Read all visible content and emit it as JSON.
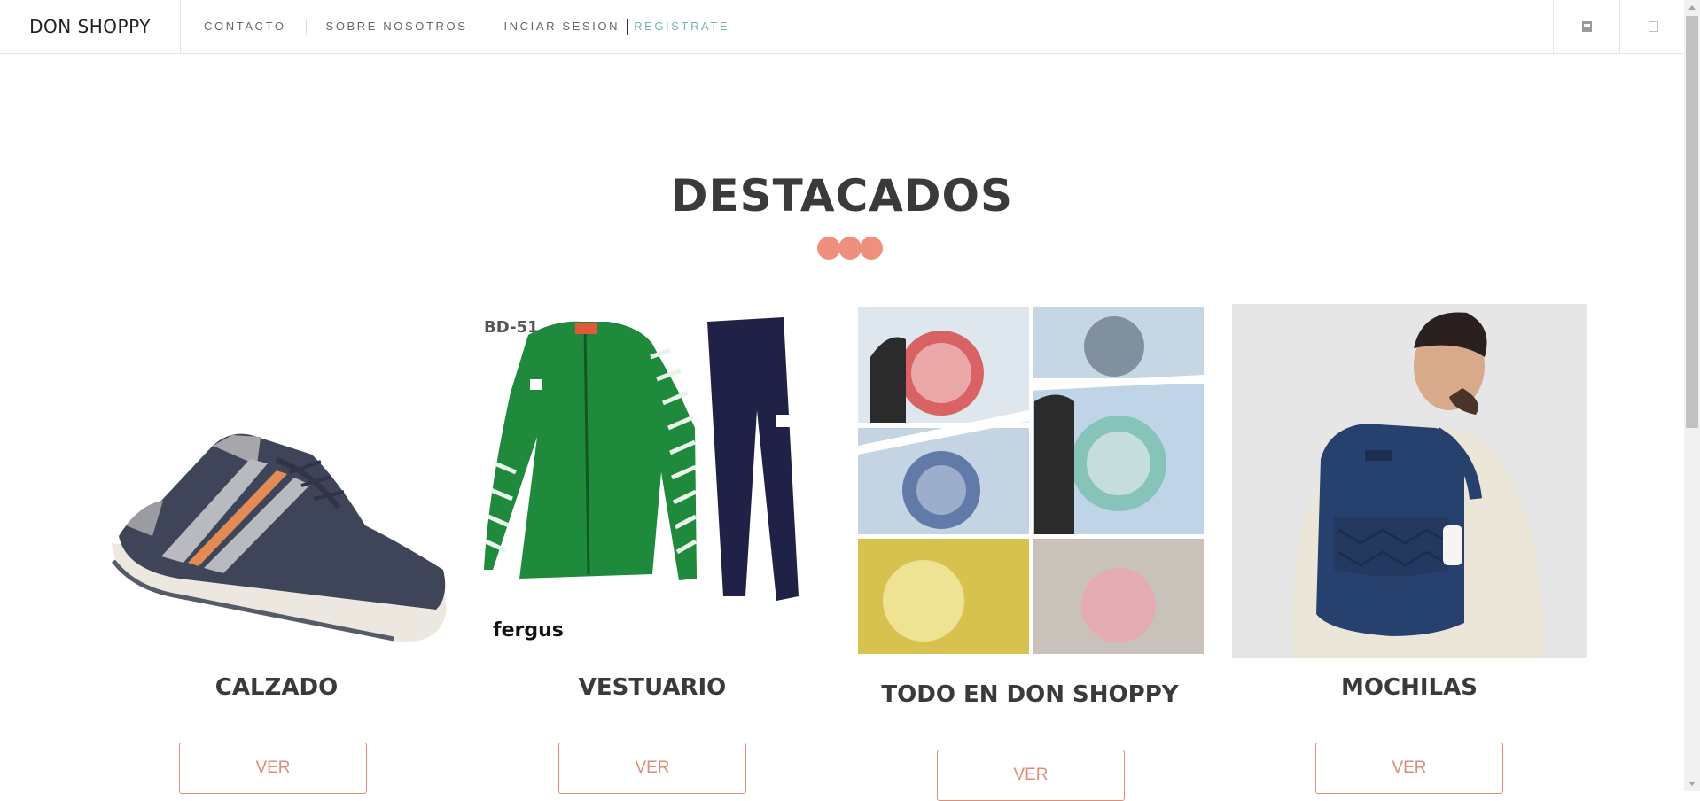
{
  "header": {
    "brand": "DON SHOPPY",
    "nav": [
      "CONTACTO",
      "SOBRE NOSOTROS"
    ],
    "login": "INCIAR SESION",
    "register": "REGISTRATE",
    "icons": [
      "user-icon",
      "cart-icon"
    ]
  },
  "section": {
    "title": "DESTACADOS"
  },
  "cards": [
    {
      "title": "CALZADO",
      "button": "VER",
      "image": "sneaker-image"
    },
    {
      "title": "VESTUARIO",
      "button": "VER",
      "image": "tracksuit-image",
      "image_text": [
        "BD-51",
        "fergus"
      ]
    },
    {
      "title": "TODO EN DON SHOPPY",
      "button": "VER",
      "image": "pet-backpack-collage-image"
    },
    {
      "title": "MOCHILAS",
      "button": "VER",
      "image": "backpack-model-image"
    }
  ],
  "colors": {
    "accent": "#e08d78",
    "dots": "#ef8f7c",
    "register": "#6fb7b2",
    "title": "#3a3a3a"
  }
}
